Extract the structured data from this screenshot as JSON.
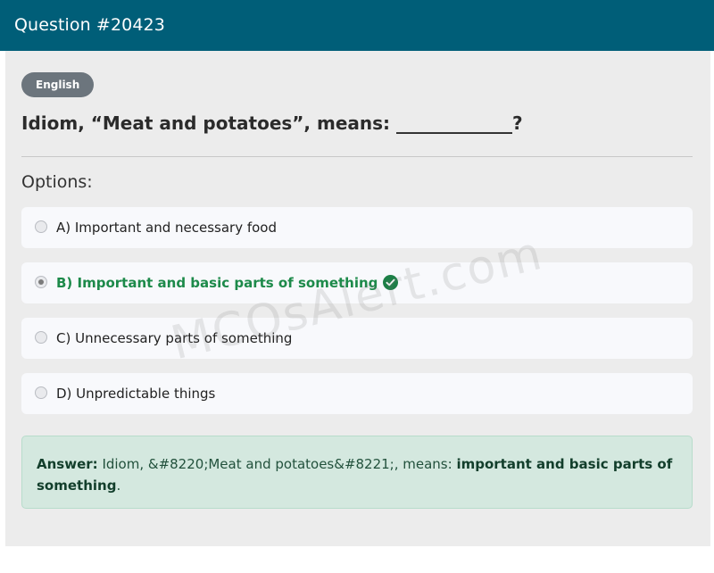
{
  "header": {
    "title": "Question #20423"
  },
  "badge": {
    "label": "English"
  },
  "question": {
    "text": "Idiom, “Meat and potatoes”, means: _____________?"
  },
  "options_label": "Options:",
  "options": [
    {
      "label": "A) Important and necessary food",
      "selected": false,
      "correct": false
    },
    {
      "label": "B) Important and basic parts of something",
      "selected": true,
      "correct": true
    },
    {
      "label": "C) Unnecessary parts of something",
      "selected": false,
      "correct": false
    },
    {
      "label": "D) Unpredictable things",
      "selected": false,
      "correct": false
    }
  ],
  "answer": {
    "prefix": "Answer:",
    "body": "Idiom, &#8220;Meat and potatoes&#8221;, means:",
    "highlight": "important and basic parts of something",
    "suffix": "."
  },
  "watermark": "MCQsAlert.com",
  "icons": {
    "correct": "check-circle-icon",
    "radio": "radio-button-icon"
  },
  "colors": {
    "header_bg": "#005e78",
    "badge_bg": "#6c757d",
    "correct_text": "#1d8a4a",
    "answer_bg": "#d4e8df"
  }
}
